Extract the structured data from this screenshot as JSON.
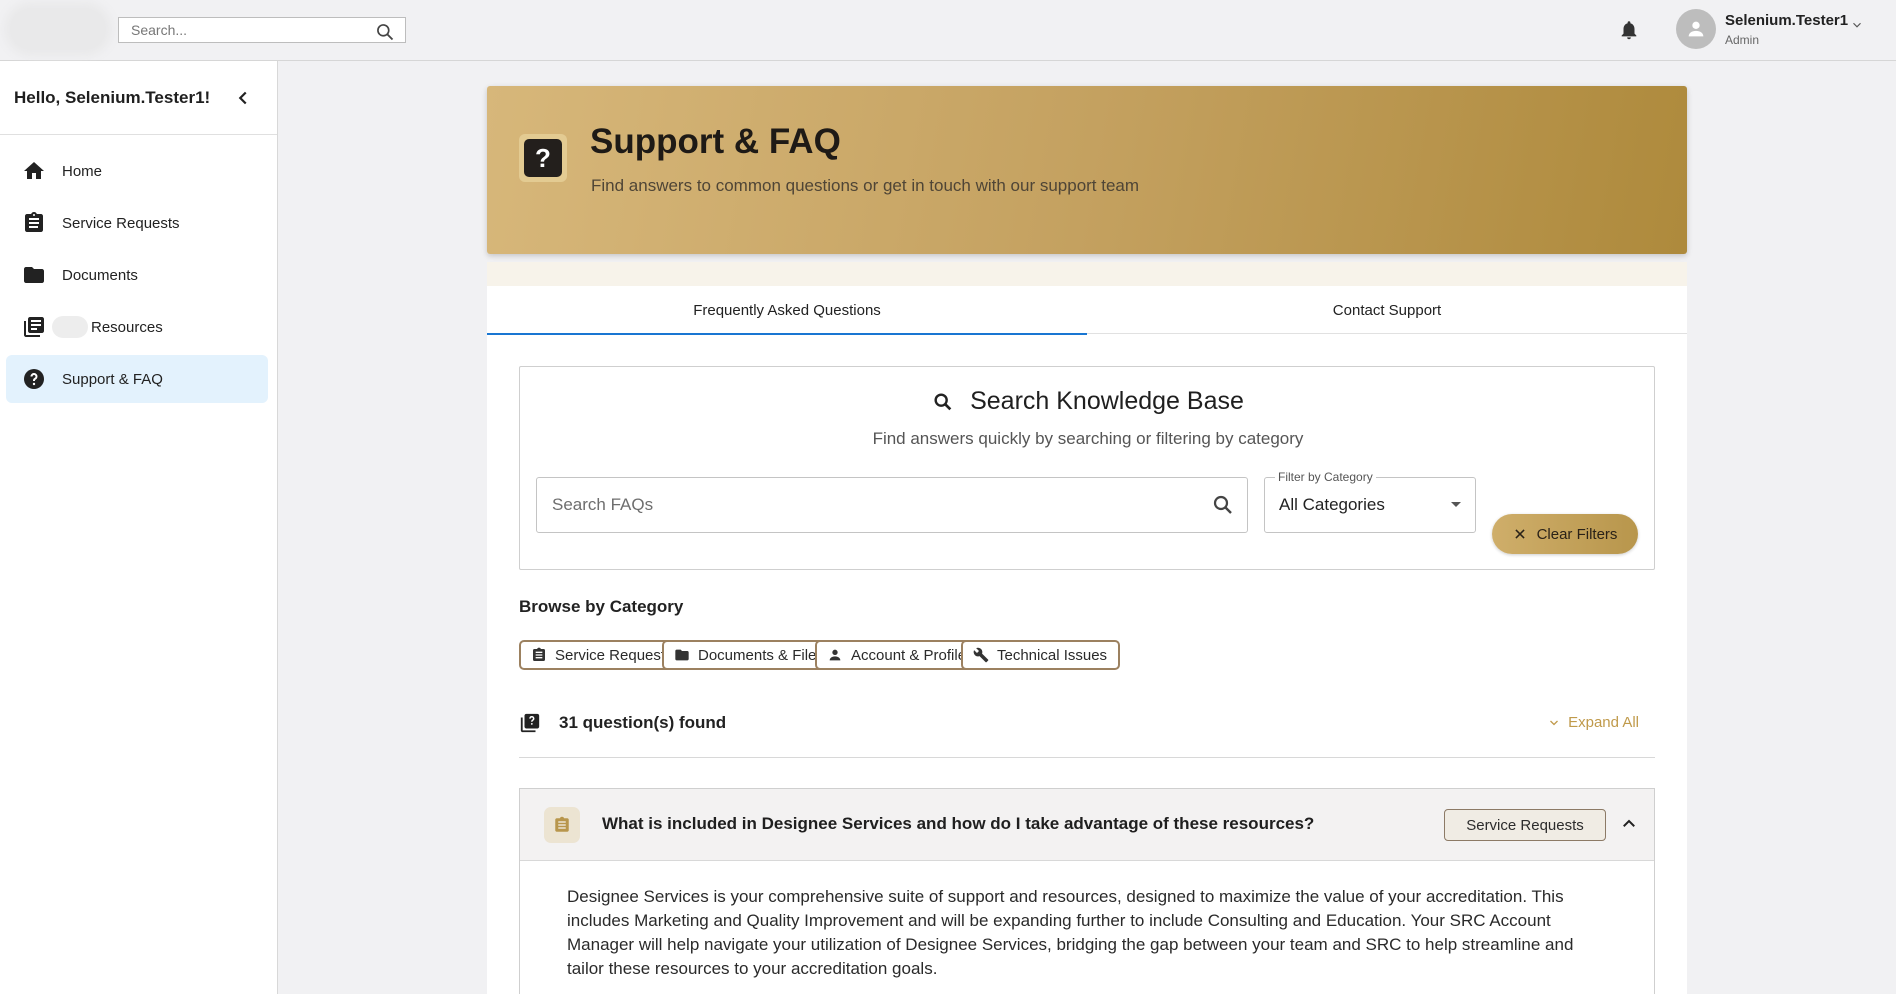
{
  "topbar": {
    "search_placeholder": "Search...",
    "user_name": "Selenium.Tester1",
    "user_role": "Admin"
  },
  "sidebar": {
    "greeting": "Hello, Selenium.Tester1!",
    "items": [
      {
        "label": "Home",
        "icon": "home-icon"
      },
      {
        "label": "Service Requests",
        "icon": "clipboard-icon"
      },
      {
        "label": "Documents",
        "icon": "folder-icon"
      },
      {
        "label": "Resources",
        "icon": "library-books-icon"
      },
      {
        "label": "Support & FAQ",
        "icon": "help-circle-icon",
        "active": true
      }
    ]
  },
  "hero": {
    "icon": "?",
    "title": "Support & FAQ",
    "subtitle": "Find answers to common questions or get in touch with our support team"
  },
  "tabs": [
    {
      "label": "Frequently Asked Questions",
      "active": true
    },
    {
      "label": "Contact Support",
      "active": false
    }
  ],
  "knowledge_base": {
    "title": "Search Knowledge Base",
    "subtitle": "Find answers quickly by searching or filtering by category",
    "search_placeholder": "Search FAQs",
    "filter_label": "Filter by Category",
    "filter_value": "All Categories",
    "clear_label": "Clear Filters"
  },
  "browse": {
    "title": "Browse by Category",
    "categories": [
      {
        "label": "Service Requests",
        "icon": "clipboard-icon"
      },
      {
        "label": "Documents & Files",
        "icon": "folder-icon"
      },
      {
        "label": "Account & Profile",
        "icon": "person-icon"
      },
      {
        "label": "Technical Issues",
        "icon": "wrench-icon"
      }
    ]
  },
  "results": {
    "count_text": "31 question(s) found",
    "expand_all": "Expand All"
  },
  "faq": {
    "question": "What is included in Designee Services and how do I take advantage of these resources?",
    "category": "Service Requests",
    "answer": "Designee Services is your comprehensive suite of support and resources, designed to maximize the value of your accreditation. This includes Marketing and Quality Improvement and will be expanding further to include Consulting and Education. Your SRC Account Manager will help navigate your utilization of Designee Services, bridging the gap between your team and SRC to help streamline and tailor these resources to your accreditation goals."
  },
  "colors": {
    "accent_gold": "#c09a4b",
    "active_nav_bg": "#e3f2fd",
    "tab_indicator": "#1976d2"
  }
}
